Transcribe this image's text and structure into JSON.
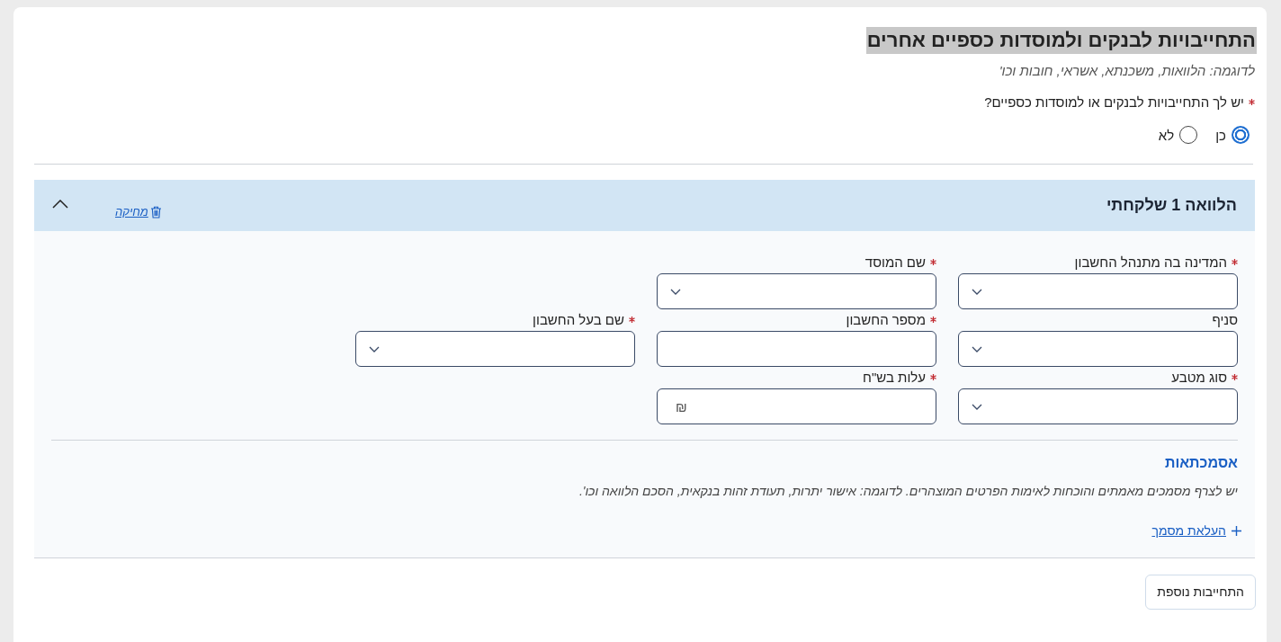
{
  "header": {
    "title": "התחייבויות לבנקים ולמוסדות כספיים אחרים",
    "subtitle": "לדוגמה: הלוואות, משכנתא, אשראי, חובות וכו'"
  },
  "question": {
    "text": "יש לך התחייבויות לבנקים או למוסדות כספיים?",
    "required": true,
    "options": [
      {
        "label": "כן",
        "selected": true
      },
      {
        "label": "לא",
        "selected": false
      }
    ]
  },
  "loans": [
    {
      "title": "הלוואה 1 שלקחתי",
      "expanded": true,
      "delete_label": "מחיקה",
      "field_rows": [
        [
          {
            "label": "המדינה בה מתנהל החשבון",
            "required": true,
            "kind": "select"
          },
          {
            "label": "שם המוסד",
            "required": true,
            "kind": "select"
          }
        ],
        [
          {
            "label": "סניף",
            "required": false,
            "kind": "select"
          },
          {
            "label": "מספר החשבון",
            "required": true,
            "kind": "text"
          },
          {
            "label": "שם בעל החשבון",
            "required": true,
            "kind": "select"
          }
        ],
        [
          {
            "label": "סוג מטבע",
            "required": true,
            "kind": "select"
          },
          {
            "label": "עלות בש\"ח",
            "required": true,
            "kind": "currency",
            "symbol": "₪"
          }
        ]
      ],
      "documents": {
        "title": "אסמכתאות",
        "description": "יש לצרף מסמכים מאמתים והוכחות לאימות הפרטים המוצהרים. לדוגמה: אישור יתרות, תעודת זהות בנקאית, הסכם הלוואה וכו'.",
        "upload_label": "העלאת מסמך"
      }
    }
  ],
  "add_button": "התחייבות נוספת"
}
